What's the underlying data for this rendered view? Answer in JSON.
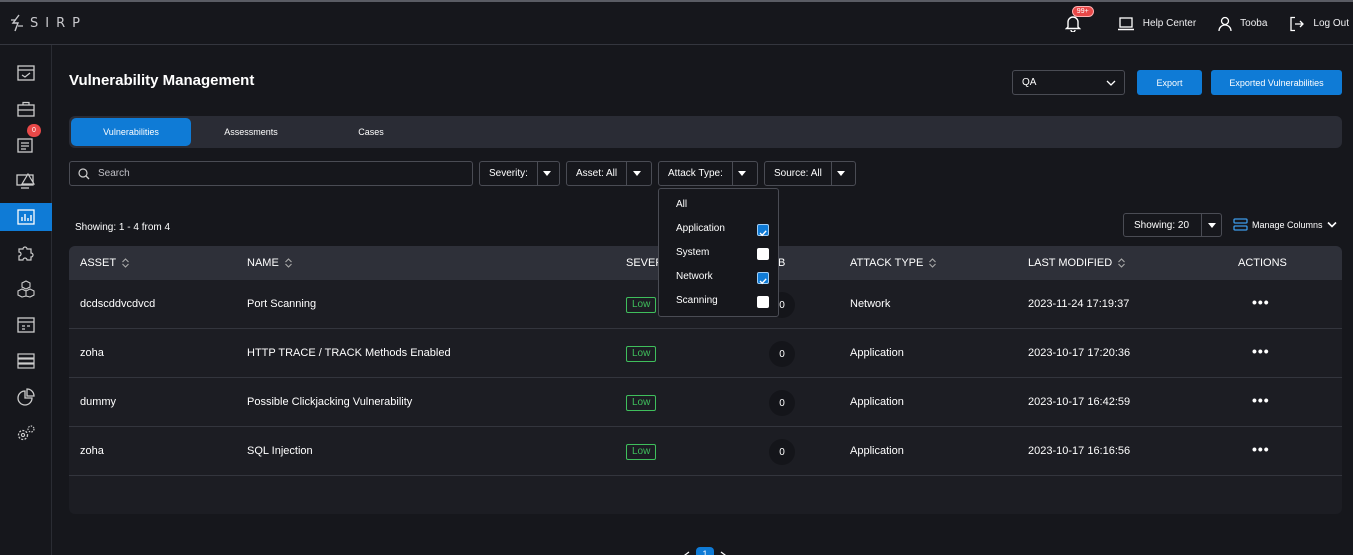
{
  "app": {
    "logo_text": "SIRP"
  },
  "topbar": {
    "notification_count": "99+",
    "help_center": "Help Center",
    "user": "Tooba",
    "logout": "Log Out"
  },
  "sidebar": {
    "icons": [
      "dashboard-icon",
      "briefcase-icon",
      "cases-icon",
      "alert-monitor-icon",
      "vulnerability-chart-icon",
      "puzzle-icon",
      "cubes-icon",
      "calendar-panel-icon",
      "server-icon",
      "pie-chart-icon",
      "settings-icon"
    ],
    "cases_badge": "0",
    "active_index": 4
  },
  "page": {
    "title": "Vulnerability Management",
    "org_select": "QA",
    "export_label": "Export",
    "exported_label": "Exported Vulnerabilities"
  },
  "tabs": [
    "Vulnerabilities",
    "Assessments",
    "Cases"
  ],
  "filters": {
    "search_placeholder": "Search",
    "severity": "Severity:",
    "asset": "Asset: All",
    "attack_type": "Attack Type:",
    "source": "Source: All"
  },
  "attack_type_dropdown": [
    {
      "label": "All",
      "checkbox": false,
      "checked": false
    },
    {
      "label": "Application",
      "checkbox": true,
      "checked": true
    },
    {
      "label": "System",
      "checkbox": true,
      "checked": false
    },
    {
      "label": "Network",
      "checkbox": true,
      "checked": true
    },
    {
      "label": "Scanning",
      "checkbox": true,
      "checked": false
    }
  ],
  "list": {
    "showing": "Showing: 1 - 4 from 4",
    "page_size": "Showing: 20",
    "manage_columns": "Manage Columns"
  },
  "table": {
    "headers": [
      "ASSET",
      "NAME",
      "SEVERITY",
      "",
      "ATTACK TYPE",
      "LAST MODIFIED",
      "ACTIONS"
    ],
    "header_visible": [
      "ASSET",
      "NAME",
      "SEVER",
      "B",
      "ATTACK TYPE",
      "LAST MODIFIED",
      "ACTIONS"
    ],
    "rows": [
      {
        "asset": "dcdscddvcdvcd",
        "name": "Port Scanning",
        "severity": "Low",
        "count": "0",
        "attack_type": "Network",
        "last_modified": "2023-11-24 17:19:37"
      },
      {
        "asset": "zoha",
        "name": "HTTP TRACE / TRACK Methods Enabled",
        "severity": "Low",
        "count": "0",
        "attack_type": "Application",
        "last_modified": "2023-10-17 17:20:36"
      },
      {
        "asset": "dummy",
        "name": "Possible Clickjacking Vulnerability",
        "severity": "Low",
        "count": "0",
        "attack_type": "Application",
        "last_modified": "2023-10-17 16:42:59"
      },
      {
        "asset": "zoha",
        "name": "SQL Injection",
        "severity": "Low",
        "count": "0",
        "attack_type": "Application",
        "last_modified": "2023-10-17 16:16:56"
      }
    ],
    "action_glyph": "•••"
  },
  "pagination": {
    "current": "1"
  },
  "colors": {
    "accent": "#0f7bd6",
    "severity_low": "#3fbf5c",
    "badge_red": "#e84848"
  }
}
